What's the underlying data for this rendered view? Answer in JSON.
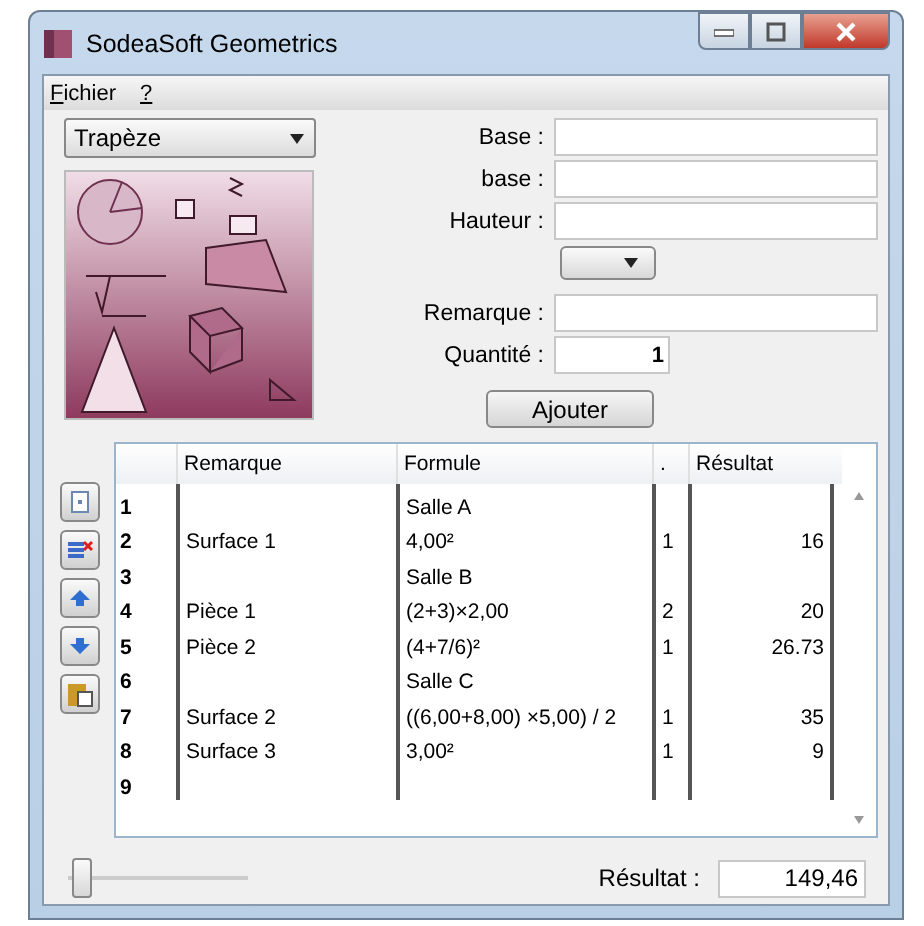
{
  "window": {
    "title": "SodeaSoft Geometrics"
  },
  "menu": [
    {
      "label": "Fichier"
    },
    {
      "label": "?"
    }
  ],
  "shape_select": {
    "value": "Trapèze"
  },
  "fields": [
    {
      "label": "Base :",
      "kind": "text"
    },
    {
      "label": "base :",
      "kind": "text"
    },
    {
      "label": "Hauteur :",
      "kind": "text"
    },
    {
      "kind": "dropdown"
    },
    {
      "label": "Remarque :",
      "kind": "text"
    },
    {
      "label": "Quantité :",
      "value": "1",
      "kind": "number"
    }
  ],
  "add_button": "Ajouter",
  "table": {
    "columns": [
      "Remarque",
      "Formule",
      ".",
      "Résultat"
    ],
    "rows": [
      {
        "num": "1",
        "formula": "Salle A"
      },
      {
        "num": "2",
        "remark": "Surface 1",
        "formula": "4,00²",
        "qty": "1",
        "result": "16"
      },
      {
        "num": "3",
        "formula": "Salle B"
      },
      {
        "num": "4",
        "remark": "Pièce 1",
        "formula": "(2+3)×2,00",
        "qty": "2",
        "result": "20"
      },
      {
        "num": "5",
        "remark": "Pièce 2",
        "formula": "(4+7/6)²",
        "qty": "1",
        "result": "26.73"
      },
      {
        "num": "6",
        "formula": "Salle C"
      },
      {
        "num": "7",
        "remark": "Surface 2",
        "formula": "((6,00+8,00) ×5,00) / 2",
        "qty": "1",
        "result": "35"
      },
      {
        "num": "8",
        "remark": "Surface 3",
        "formula": "3,00²",
        "qty": "1",
        "result": "9"
      },
      {
        "num": "9"
      }
    ]
  },
  "zoom_slider": {
    "level": 0.05
  },
  "total": {
    "label": "Résultat :",
    "value": "149,46"
  }
}
